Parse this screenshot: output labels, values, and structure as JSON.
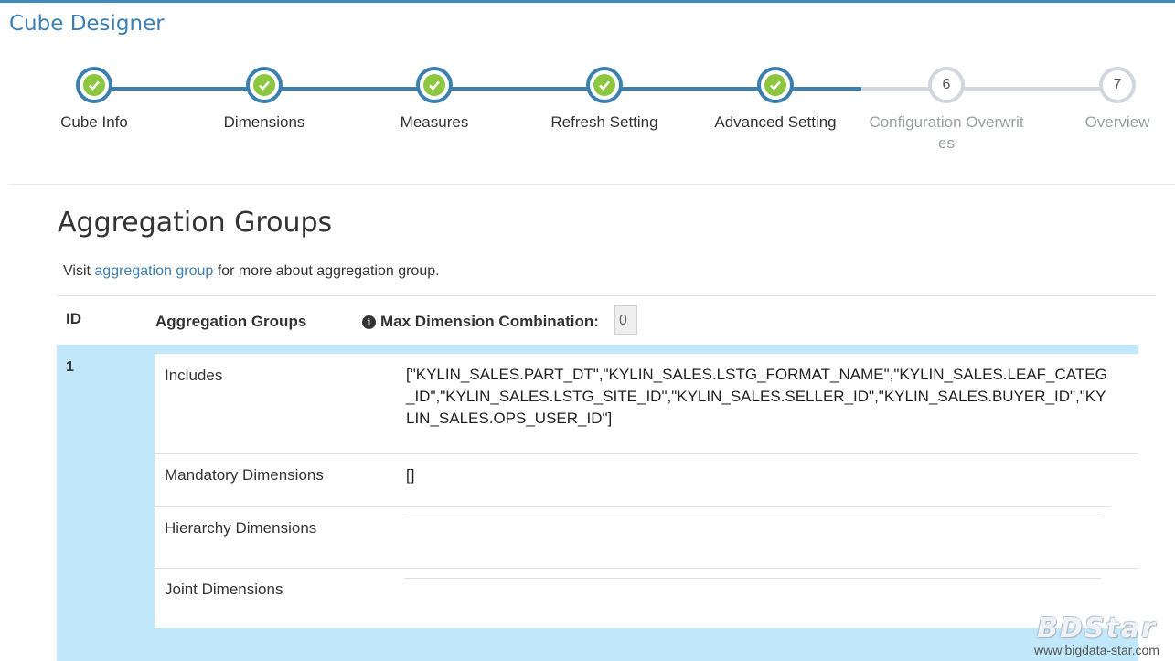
{
  "app": {
    "title": "Cube Designer"
  },
  "wizard": {
    "steps": [
      {
        "label": "Cube Info",
        "status": "done",
        "number": ""
      },
      {
        "label": "Dimensions",
        "status": "done",
        "number": ""
      },
      {
        "label": "Measures",
        "status": "done",
        "number": ""
      },
      {
        "label": "Refresh Setting",
        "status": "done",
        "number": ""
      },
      {
        "label": "Advanced Setting",
        "status": "done",
        "number": ""
      },
      {
        "label": "Configuration Overwrites",
        "status": "pending",
        "number": "6"
      },
      {
        "label": "Overview",
        "status": "pending",
        "number": "7"
      }
    ],
    "colors": {
      "done_line": "#3c7fb1",
      "pending_line": "#d2d6de",
      "check": "#8dc63f"
    }
  },
  "section": {
    "title": "Aggregation Groups",
    "visit_prefix": "Visit",
    "visit_link": "aggregation group",
    "visit_suffix": "for more about aggregation group."
  },
  "table": {
    "headers": {
      "id": "ID",
      "groups": "Aggregation Groups",
      "max_dim_label": "Max Dimension Combination:"
    },
    "max_dim_value": "0",
    "rows": [
      {
        "id": "1",
        "includes_label": "Includes",
        "includes_value": "[\"KYLIN_SALES.PART_DT\",\"KYLIN_SALES.LSTG_FORMAT_NAME\",\"KYLIN_SALES.LEAF_CATEG_ID\",\"KYLIN_SALES.LSTG_SITE_ID\",\"KYLIN_SALES.SELLER_ID\",\"KYLIN_SALES.BUYER_ID\",\"KYLIN_SALES.OPS_USER_ID\"]",
        "mandatory_label": "Mandatory Dimensions",
        "mandatory_value": "[]",
        "hierarchy_label": "Hierarchy Dimensions",
        "joint_label": "Joint Dimensions"
      }
    ]
  },
  "watermark": {
    "logo": "BDStar",
    "url": "www.bigdata-star.com"
  }
}
